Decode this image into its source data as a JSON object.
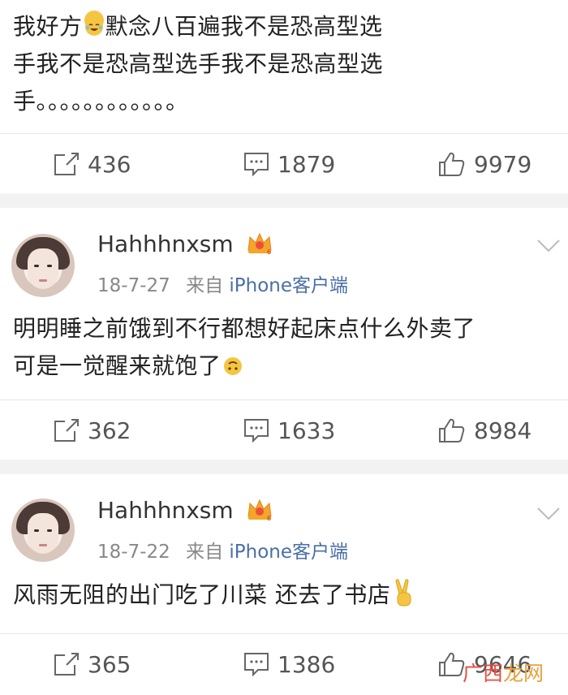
{
  "posts": [
    {
      "text_lines": [
        "我好方",
        "默念八百遍我不是恐高型选",
        "手我不是恐高型选手我不是恐高型选",
        "手。。。。。。。。。。。。"
      ],
      "emoji": "laughing-crying-emoji",
      "actions": {
        "reposts": "436",
        "comments": "1879",
        "likes": "9979"
      }
    },
    {
      "username": "Hahhhnxsm",
      "date": "18-7-27",
      "from_label": "来自",
      "source": "iPhone客户端",
      "text_lines": [
        "明明睡之前饿到不行都想好起床点什么外卖了",
        "可是一觉醒来就饱了"
      ],
      "emoji": "upside-down-face-emoji",
      "actions": {
        "reposts": "362",
        "comments": "1633",
        "likes": "8984"
      }
    },
    {
      "username": "Hahhhnxsm",
      "date": "18-7-22",
      "from_label": "来自",
      "source": "iPhone客户端",
      "text_lines": [
        "风雨无阻的出门吃了川菜 还去了书店"
      ],
      "emoji": "victory-hand-emoji",
      "actions": {
        "reposts": "365",
        "comments": "1386",
        "likes": "9646"
      }
    }
  ],
  "watermark": {
    "part1": "广西",
    "part2": "龙网"
  }
}
